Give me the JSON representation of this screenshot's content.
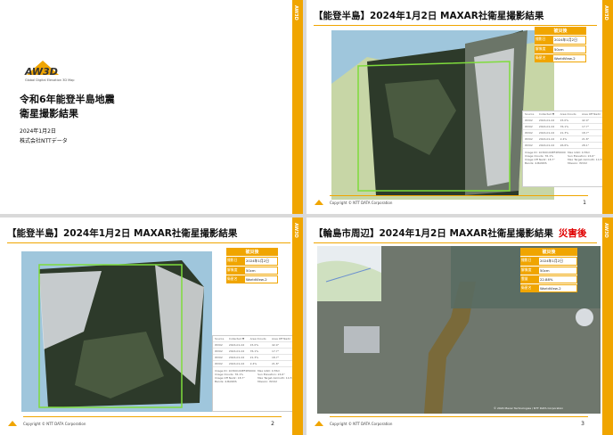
{
  "side_tab": "AW3D",
  "cover": {
    "logo_text": "AW3D",
    "logo_sub": "Global Digital Elevation 3D Map",
    "title_line1": "令和6年能登半島地震",
    "title_line2": "衛星撮影結果",
    "date": "2024年1月2日",
    "org": "株式会社NTTデータ"
  },
  "footer": "Copyright © NTT DATA Corporation",
  "info_box": {
    "header": "被災後",
    "rows": [
      {
        "key": "撮影日",
        "value": "2024年1月2日"
      },
      {
        "key": "解像度",
        "value": "50cm"
      },
      {
        "key": "衛星名",
        "value": "WorldView-2"
      }
    ]
  },
  "panel": {
    "headers": [
      "Source",
      "Collected ▼",
      "Area Clouds",
      "Area Off Nadir"
    ],
    "rows": [
      [
        "WV02",
        "2024-01-02",
        "15.0%",
        "42.9°"
      ],
      [
        "WV02",
        "2024-01-02",
        "76.1%",
        "17.7°"
      ],
      [
        "WV02",
        "2024-01-02",
        "21.3%",
        "18.7°"
      ],
      [
        "WV02",
        "2024-01-02",
        "2.4%",
        "21.8°"
      ],
      [
        "WV02",
        "2024-01-02",
        "26.6%",
        "28.1°"
      ]
    ],
    "meta_left": [
      "Image ID: 10300100EF2E6000",
      "Image Clouds: 76.1%",
      "Image Off Nadir: 18.7°",
      "Bands: 4-BANDS"
    ],
    "meta_right": [
      "Max GSD: 0.55m",
      "Sun Elevation: 24.6°",
      "Max Target Azimuth: 14.5°",
      "Mission: WV02"
    ]
  },
  "slides": [
    {
      "title": "【能登半島】2024年1月2日 MAXAR社衛星撮影結果",
      "page": "1"
    },
    {
      "title": "【能登半島】2024年1月2日 MAXAR社衛星撮影結果",
      "page": "2"
    },
    {
      "title": "【輪島市周辺】2024年1月2日 MAXAR社衛星撮影結果",
      "title_red": "災害後",
      "page": "3",
      "info_rows": [
        {
          "key": "撮影日",
          "value": "2024年1月2日"
        },
        {
          "key": "解像度",
          "value": "50cm"
        },
        {
          "key": "雲量",
          "value": "22.88%"
        },
        {
          "key": "衛星名",
          "value": "WorldView-2"
        }
      ],
      "image_credit": "© 2024 Maxar Technologies / NTT DATA Corporation"
    }
  ]
}
